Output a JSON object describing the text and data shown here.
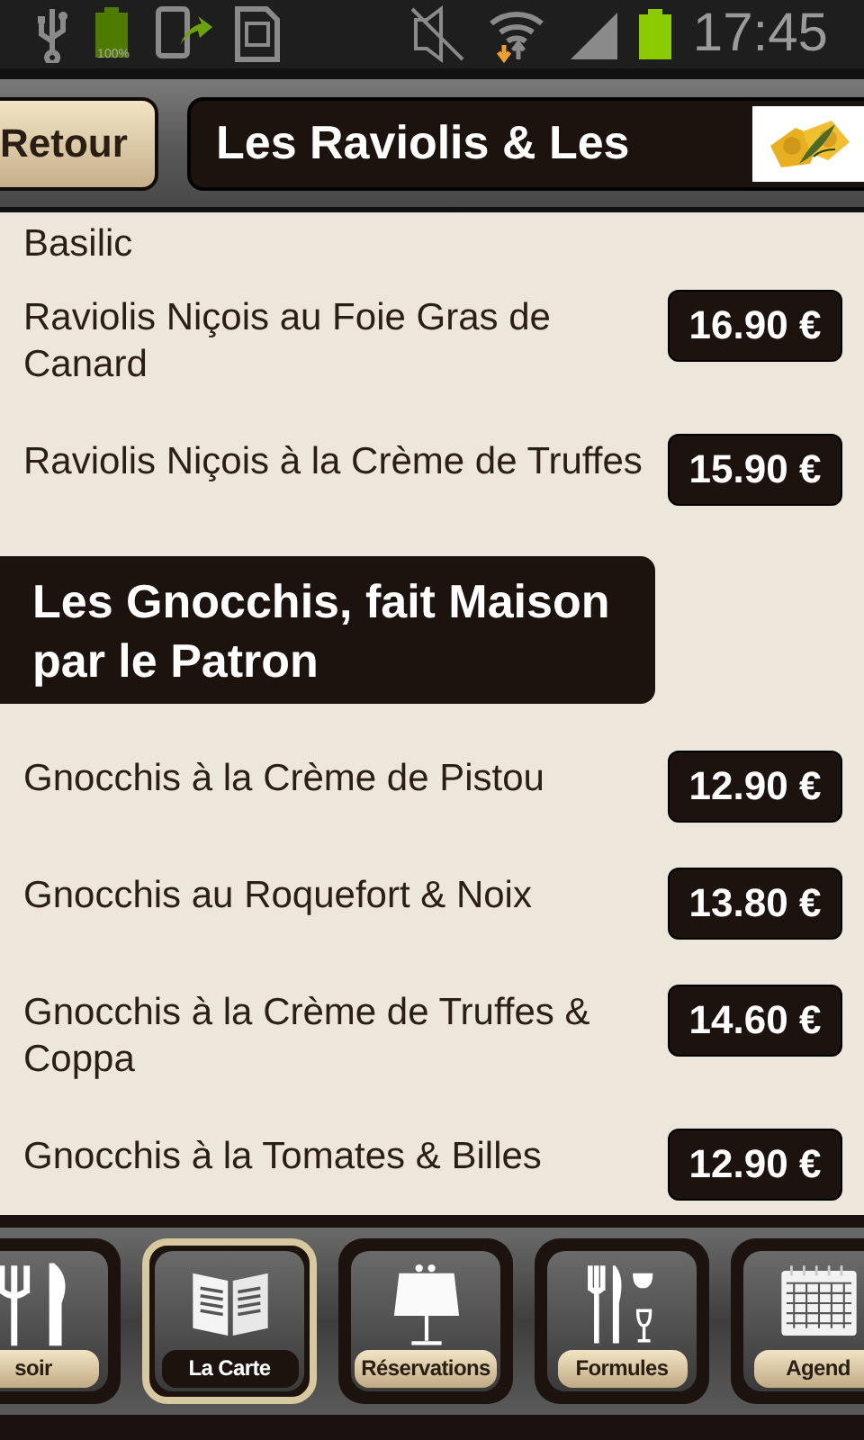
{
  "status_bar": {
    "battery_label": "100%",
    "time": "17:45"
  },
  "header": {
    "back_button": "Retour",
    "title": "Les Raviolis & Les"
  },
  "menu": [
    {
      "kind": "item",
      "name": "Basilic"
    },
    {
      "kind": "item",
      "name": "Raviolis Niçois au Foie Gras de Canard",
      "price": "16.90 €"
    },
    {
      "kind": "item",
      "name": "Raviolis Niçois à la Crème de Truffes",
      "price": "15.90 €"
    },
    {
      "kind": "section",
      "title": "Les Gnocchis, fait Maison par le Patron"
    },
    {
      "kind": "item",
      "name": "Gnocchis à la Crème de Pistou",
      "price": "12.90 €"
    },
    {
      "kind": "item",
      "name": "Gnocchis au Roquefort & Noix",
      "price": "13.80 €"
    },
    {
      "kind": "item",
      "name": "Gnocchis à la Crème de Truffes & Coppa",
      "price": "14.60 €"
    },
    {
      "kind": "item",
      "name": "Gnocchis à la Tomates & Billes",
      "price": "12.90 €"
    }
  ],
  "nav": [
    {
      "kind": "cutlery",
      "label": "soir",
      "selected": false
    },
    {
      "kind": "book",
      "label": "La Carte",
      "selected": true
    },
    {
      "kind": "table",
      "label": "Réservations",
      "selected": false
    },
    {
      "kind": "meal",
      "label": "Formules",
      "selected": false
    },
    {
      "kind": "calendar",
      "label": "Agend",
      "selected": false
    }
  ]
}
